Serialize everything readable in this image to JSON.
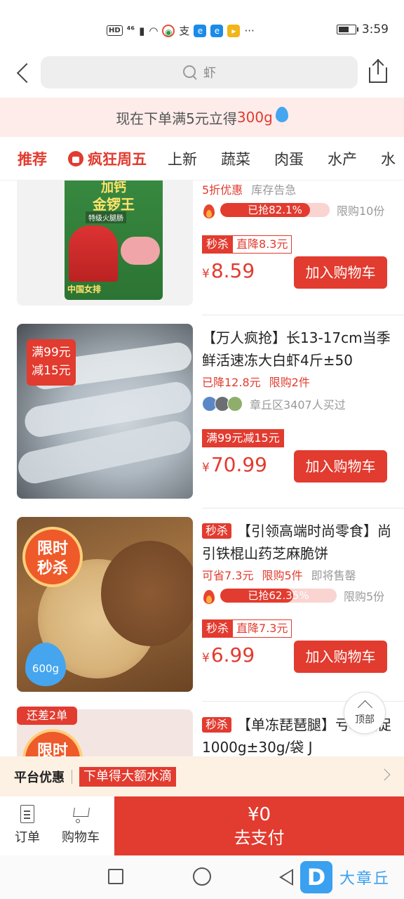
{
  "status_bar": {
    "hd": "HD",
    "signal": "⁴⁶",
    "app_text": "支",
    "dots": "···",
    "time": "3:59",
    "battery_level": 0.7
  },
  "header": {
    "search_text": "虾"
  },
  "promo": {
    "prefix": "现在下单满5元立得",
    "highlight": "300g"
  },
  "tabs": [
    {
      "label": "推荐"
    },
    {
      "label": "疯狂周五"
    },
    {
      "label": "上新"
    },
    {
      "label": "蔬菜"
    },
    {
      "label": "肉蛋"
    },
    {
      "label": "水产"
    },
    {
      "label": "水"
    }
  ],
  "products": [
    {
      "thumb_lines": [
        "加钙",
        "金锣王",
        "特级火腿肠",
        "中国女排"
      ],
      "meta": [
        "5折优惠",
        "库存告急"
      ],
      "progress_label": "已抢82.1%",
      "progress": 0.821,
      "limit": "限购10份",
      "badge_a": "秒杀",
      "badge_b": "直降8.3元",
      "currency": "¥",
      "price": "8.59",
      "cart_label": "加入购物车"
    },
    {
      "thumb_badge": [
        "满99元",
        "减15元"
      ],
      "title": "【万人疯抢】长13-17cm当季鲜活速冻大白虾4斤±50",
      "meta": [
        "已降12.8元",
        "限购2件"
      ],
      "buyers": "章丘区3407人买过",
      "badge_single": "满99元减15元",
      "currency": "¥",
      "price": "70.99",
      "cart_label": "加入购物车"
    },
    {
      "thumb_badge": [
        "限时",
        "秒杀"
      ],
      "thumb_drop": "600g",
      "tag": "秒杀",
      "title": "【引领高端时尚零食】尚引铁棍山药芝麻脆饼",
      "meta": [
        "可省7.3元",
        "限购5件",
        "即将售罄"
      ],
      "progress_label": "已抢62.35%",
      "progress": 0.6235,
      "limit": "限购5份",
      "badge_a": "秒杀",
      "badge_b": "直降7.3元",
      "currency": "¥",
      "price": "6.99",
      "cart_label": "加入购物车"
    },
    {
      "thumb_pill": "还差2单",
      "thumb_badge": [
        "限时",
        "秒杀"
      ],
      "tag": "秒杀",
      "title": "【单冻琵琶腿】亏本大促1000g±30g/袋 J"
    }
  ],
  "top_button": "顶部",
  "platform": {
    "label": "平台优惠",
    "tag": "下单得大额水滴"
  },
  "bottom_bar": {
    "orders": "订单",
    "cart": "购物车",
    "amount": "¥0",
    "pay": "去支付"
  },
  "watermark": {
    "logo": "D",
    "text": "大章丘"
  },
  "colors": {
    "accent": "#e23b2f",
    "promo_bg": "#fdecea",
    "platform_bg": "#fdf1e4",
    "drop_blue": "#45a6ef"
  }
}
